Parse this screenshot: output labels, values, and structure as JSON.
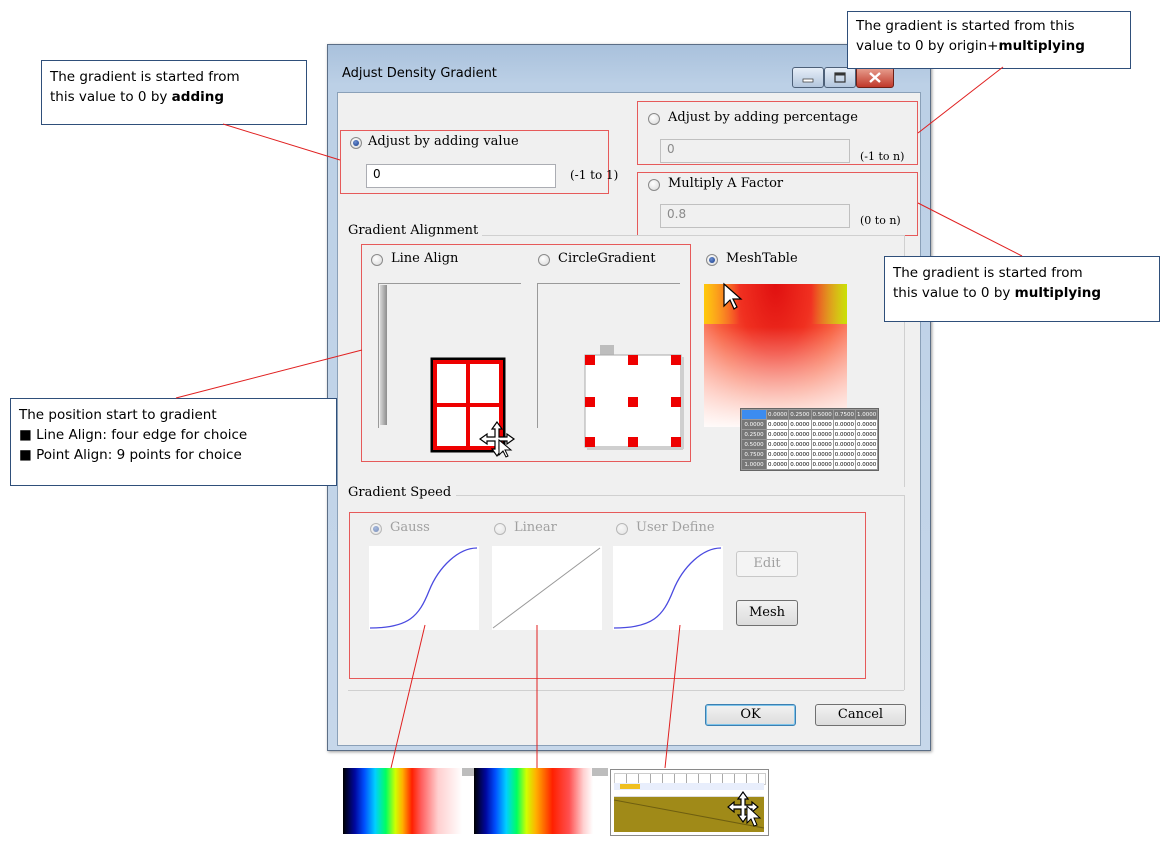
{
  "window": {
    "title": "Adjust Density Gradient",
    "minimize_icon": "minimize-icon",
    "maximize_icon": "maximize-icon",
    "close_icon": "close-icon"
  },
  "adjust": {
    "adding_value": {
      "label": "Adjust by adding value",
      "value": "0",
      "range": "(-1 to 1)",
      "selected": true
    },
    "adding_percentage": {
      "label": "Adjust by adding percentage",
      "value": "0",
      "range": "(-1 to n)",
      "selected": false
    },
    "multiply_factor": {
      "label": "Multiply A Factor",
      "value": "0.8",
      "range": "(0 to n)",
      "selected": false
    }
  },
  "alignment": {
    "group_label": "Gradient Alignment",
    "line_align": "Line Align",
    "circle_gradient": "CircleGradient",
    "mesh_table": "MeshTable",
    "selected": "MeshTable"
  },
  "mesh_table": {
    "headers": [
      "0.0000",
      "0.2500",
      "0.5000",
      "0.7500",
      "1.0000"
    ],
    "rows": [
      {
        "h": "0.0000",
        "cells": [
          "0.0000",
          "0.0000",
          "0.0000",
          "0.0000",
          "0.0000"
        ]
      },
      {
        "h": "0.2500",
        "cells": [
          "0.0000",
          "0.0000",
          "0.0000",
          "0.0000",
          "0.0000"
        ]
      },
      {
        "h": "0.5000",
        "cells": [
          "0.0000",
          "0.0000",
          "0.0000",
          "0.0000",
          "0.0000"
        ]
      },
      {
        "h": "0.7500",
        "cells": [
          "0.0000",
          "0.0000",
          "0.0000",
          "0.0000",
          "0.0000"
        ]
      },
      {
        "h": "1.0000",
        "cells": [
          "0.0000",
          "0.0000",
          "0.0000",
          "0.0000",
          "0.0000"
        ]
      }
    ]
  },
  "speed": {
    "group_label": "Gradient Speed",
    "gauss": "Gauss",
    "linear": "Linear",
    "user_define": "User Define",
    "edit_label": "Edit",
    "mesh_label": "Mesh"
  },
  "buttons": {
    "ok": "OK",
    "cancel": "Cancel"
  },
  "callouts": {
    "adding": {
      "line1": "The gradient is started from",
      "line2_prefix": "this value to 0  by ",
      "bold": "adding"
    },
    "origin_multiplying": {
      "line1": "The gradient is started from this",
      "line2_prefix": "value to 0  by origin+",
      "bold": "multiplying"
    },
    "multiplying": {
      "line1": "The gradient is started from",
      "line2_prefix": "this value to 0  by ",
      "bold": "multiplying"
    },
    "position": {
      "line1": "The position start to gradient",
      "line2": "Line Align: four edge for choice",
      "line3": "Point Align: 9 points for choice",
      "bullet": "■"
    }
  },
  "colors": {
    "callout_line": "#e02020",
    "annotation_box": "#e65a5a",
    "curve": "#4a4ae0"
  }
}
